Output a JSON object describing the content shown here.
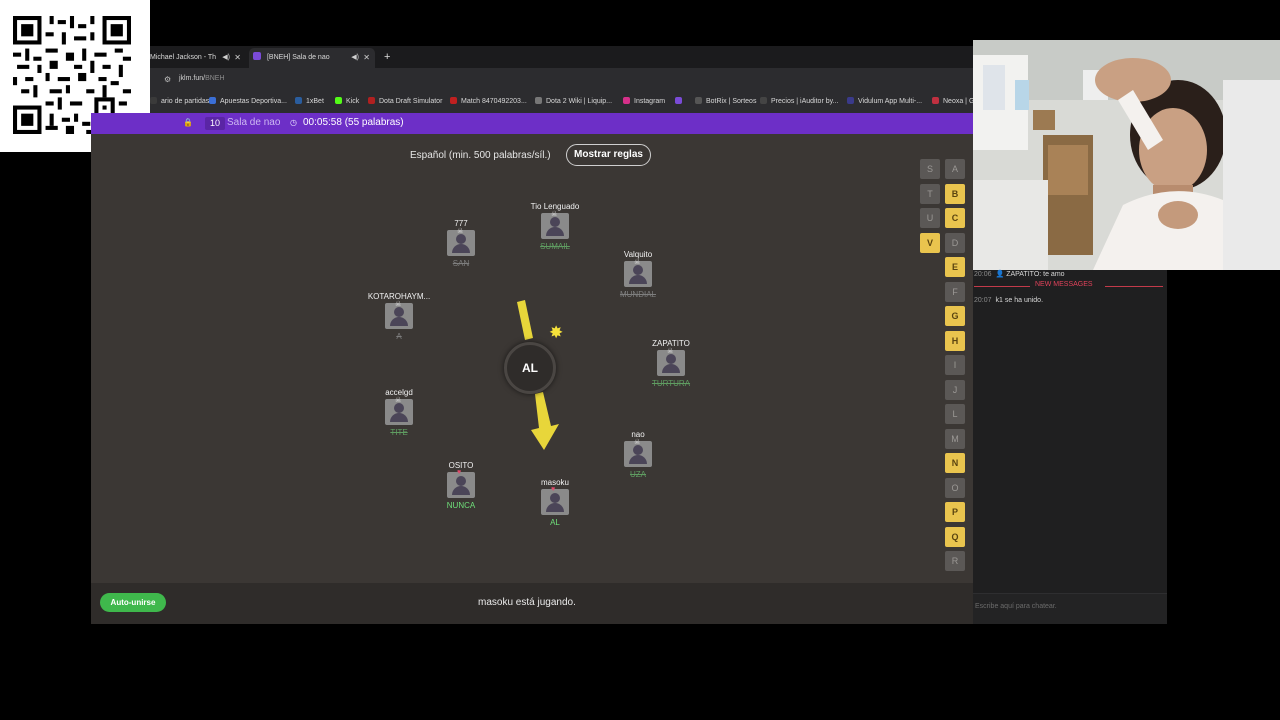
{
  "browser": {
    "tabs": [
      {
        "title": "Michael Jackson - Th"
      },
      {
        "title": "[BNEH] Sala de nao"
      }
    ],
    "new_tab": "+",
    "url_domain": "jklm.fun/",
    "url_path": "BNEH",
    "bookmarks": [
      {
        "label": "ario de partidas...",
        "color": "#3a3a3a"
      },
      {
        "label": "Apuestas Deportiva...",
        "color": "#3b6fd6"
      },
      {
        "label": "1xBet",
        "color": "#2a5d9e"
      },
      {
        "label": "Kick",
        "color": "#53fc18"
      },
      {
        "label": "Dota Draft Simulator",
        "color": "#b02020"
      },
      {
        "label": "Match 8470492203...",
        "color": "#c02020"
      },
      {
        "label": "Dota 2 Wiki | Liquip...",
        "color": "#777777"
      },
      {
        "label": "Instagram",
        "color": "#d6308a"
      },
      {
        "label": "",
        "color": "#7a4bd6"
      },
      {
        "label": "BotRix | Sorteos",
        "color": "#555555"
      },
      {
        "label": "Precios | iAuditor by...",
        "color": "#444444"
      },
      {
        "label": "Vidulum App Multi-...",
        "color": "#3a3a8a"
      },
      {
        "label": "Neoxa | G",
        "color": "#c03040"
      }
    ]
  },
  "room": {
    "player_count": "10",
    "room_name": "Sala de nao",
    "timer": "00:05:58 (55 palabras)",
    "language_line": "Español (min. 500 palabras/síl.)",
    "rules_button": "Mostrar reglas",
    "bomb_syllable": "AL",
    "auto_join": "Auto-unirse",
    "status": "masoku está jugando."
  },
  "players": [
    {
      "name": "777",
      "word": "SAN",
      "state": "dead",
      "mark": "☠"
    },
    {
      "name": "Tio Lenguado",
      "word": "SUMAIL",
      "state": "deadg",
      "mark": "☠"
    },
    {
      "name": "Valquito",
      "word": "MUNDIAL",
      "state": "dead",
      "mark": "☠"
    },
    {
      "name": "KOTAROHAYM...",
      "word": "A",
      "state": "dead",
      "mark": "☠"
    },
    {
      "name": "ZAPATITO",
      "word": "TURTURA",
      "state": "deadg",
      "mark": "☠"
    },
    {
      "name": "accelgd",
      "word": "TITE",
      "state": "deadg",
      "mark": "☠"
    },
    {
      "name": "nao",
      "word": "UZA",
      "state": "deadg",
      "mark": "☠"
    },
    {
      "name": "OSITO",
      "word": "NUNCA",
      "state": "live",
      "mark": "♥"
    },
    {
      "name": "masoku",
      "word": "AL",
      "state": "live",
      "mark": "♥"
    }
  ],
  "letters": [
    {
      "l": "S",
      "on": false
    },
    {
      "l": "A",
      "on": false
    },
    {
      "l": "T",
      "on": false
    },
    {
      "l": "B",
      "on": true
    },
    {
      "l": "U",
      "on": false
    },
    {
      "l": "C",
      "on": true
    },
    {
      "l": "V",
      "on": true
    },
    {
      "l": "D",
      "on": false
    },
    {
      "l": "E",
      "on": true
    },
    {
      "l": "F",
      "on": false
    },
    {
      "l": "G",
      "on": true
    },
    {
      "l": "H",
      "on": true
    },
    {
      "l": "I",
      "on": false
    },
    {
      "l": "J",
      "on": false
    },
    {
      "l": "L",
      "on": false
    },
    {
      "l": "M",
      "on": false
    },
    {
      "l": "N",
      "on": true
    },
    {
      "l": "O",
      "on": false
    },
    {
      "l": "P",
      "on": true
    },
    {
      "l": "Q",
      "on": true
    },
    {
      "l": "R",
      "on": false
    }
  ],
  "chat": {
    "msg1_time": "20:06",
    "msg1_text": "ZAPATITO: te amo",
    "new_messages": "NEW MESSAGES",
    "msg2_time": "20:07",
    "msg2_text": "k1 se ha unido.",
    "placeholder": "Escribe aquí para chatear."
  }
}
